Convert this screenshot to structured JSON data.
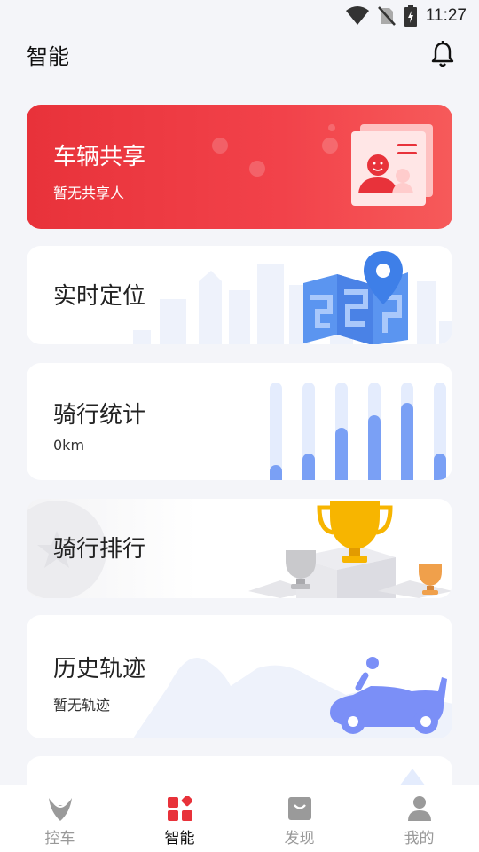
{
  "status_bar": {
    "time": "11:27"
  },
  "header": {
    "title": "智能"
  },
  "cards": {
    "share": {
      "title": "车辆共享",
      "subtitle": "暂无共享人"
    },
    "locate": {
      "title": "实时定位"
    },
    "stats": {
      "title": "骑行统计",
      "subtitle": "0km"
    },
    "rank": {
      "title": "骑行排行"
    },
    "history": {
      "title": "历史轨迹",
      "subtitle": "暂无轨迹"
    }
  },
  "bottom_nav": [
    {
      "label": "控车",
      "icon": "vehicle-logo-icon",
      "active": false
    },
    {
      "label": "智能",
      "icon": "grid-apps-icon",
      "active": true
    },
    {
      "label": "发现",
      "icon": "discover-bag-icon",
      "active": false
    },
    {
      "label": "我的",
      "icon": "profile-icon",
      "active": false
    }
  ],
  "colors": {
    "accent": "#e8323a",
    "blue": "#4a8af5",
    "bar_fill": "#7aa0f5",
    "bar_track": "#e4ecfd"
  },
  "stats_bars": [
    0.15,
    0.27,
    0.54,
    0.66,
    0.79,
    0.27
  ]
}
